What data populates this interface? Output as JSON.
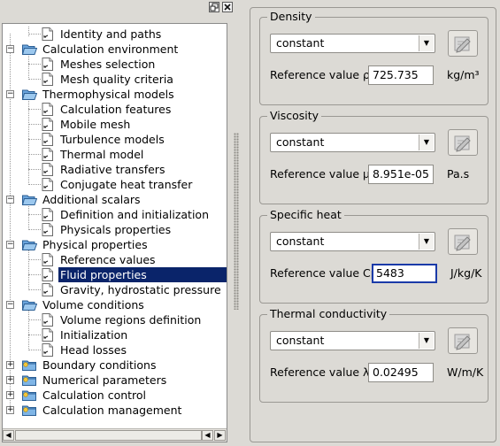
{
  "window": {
    "float_icon": "restore-icon",
    "close_icon": "close-icon"
  },
  "tree": {
    "items": [
      {
        "label": "Identity and paths",
        "level": 1,
        "icon": "document-icon"
      },
      {
        "label": "Calculation environment",
        "level": 0,
        "icon": "folder-open-icon",
        "expanded": true
      },
      {
        "label": "Meshes selection",
        "level": 1,
        "icon": "document-icon"
      },
      {
        "label": "Mesh quality criteria",
        "level": 1,
        "icon": "document-icon"
      },
      {
        "label": "Thermophysical models",
        "level": 0,
        "icon": "folder-open-icon",
        "expanded": true
      },
      {
        "label": "Calculation features",
        "level": 1,
        "icon": "document-icon"
      },
      {
        "label": "Mobile mesh",
        "level": 1,
        "icon": "document-icon"
      },
      {
        "label": "Turbulence models",
        "level": 1,
        "icon": "document-icon"
      },
      {
        "label": "Thermal model",
        "level": 1,
        "icon": "document-icon"
      },
      {
        "label": "Radiative transfers",
        "level": 1,
        "icon": "document-icon"
      },
      {
        "label": "Conjugate heat transfer",
        "level": 1,
        "icon": "document-icon"
      },
      {
        "label": "Additional scalars",
        "level": 0,
        "icon": "folder-open-icon",
        "expanded": true
      },
      {
        "label": "Definition and initialization",
        "level": 1,
        "icon": "document-icon"
      },
      {
        "label": "Physicals properties",
        "level": 1,
        "icon": "document-icon"
      },
      {
        "label": "Physical properties",
        "level": 0,
        "icon": "folder-open-icon",
        "expanded": true
      },
      {
        "label": "Reference values",
        "level": 1,
        "icon": "document-icon"
      },
      {
        "label": "Fluid properties",
        "level": 1,
        "icon": "document-icon",
        "selected": true
      },
      {
        "label": "Gravity, hydrostatic pressure",
        "level": 1,
        "icon": "document-icon"
      },
      {
        "label": "Volume conditions",
        "level": 0,
        "icon": "folder-open-icon",
        "expanded": true
      },
      {
        "label": "Volume regions definition",
        "level": 1,
        "icon": "document-icon"
      },
      {
        "label": "Initialization",
        "level": 1,
        "icon": "document-icon"
      },
      {
        "label": "Head losses",
        "level": 1,
        "icon": "document-icon"
      },
      {
        "label": "Boundary conditions",
        "level": 0,
        "icon": "folder-closed-icon",
        "expanded": false
      },
      {
        "label": "Numerical parameters",
        "level": 0,
        "icon": "folder-closed-icon",
        "expanded": false
      },
      {
        "label": "Calculation control",
        "level": 0,
        "icon": "folder-closed-icon",
        "expanded": false
      },
      {
        "label": "Calculation management",
        "level": 0,
        "icon": "folder-closed-icon",
        "expanded": false
      }
    ]
  },
  "properties": [
    {
      "title": "Density",
      "mode": "constant",
      "ref_label": "Reference value",
      "symbol": "ρ",
      "value": "725.735",
      "unit": "kg/m³"
    },
    {
      "title": "Viscosity",
      "mode": "constant",
      "ref_label": "Reference value",
      "symbol": "μ",
      "value": "8.951e-05",
      "unit": "Pa.s"
    },
    {
      "title": "Specific heat",
      "mode": "constant",
      "ref_label": "Reference value",
      "symbol": "Cp",
      "value": "5483",
      "unit": "J/kg/K"
    },
    {
      "title": "Thermal conductivity",
      "mode": "constant",
      "ref_label": "Reference value",
      "symbol": "λ",
      "value": "0.02495",
      "unit": "W/m/K"
    }
  ],
  "colors": {
    "selection": "#0a246a",
    "background": "#dcdad5",
    "folder": "#4a90d9"
  }
}
